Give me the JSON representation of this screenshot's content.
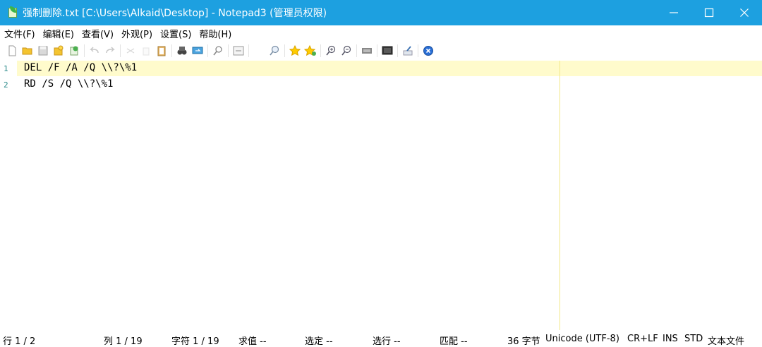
{
  "window": {
    "title": "强制删除.txt [C:\\Users\\Alkaid\\Desktop] - Notepad3  (管理员权限)",
    "titlebar_color": "#1da0e0"
  },
  "menu": [
    {
      "label": "文件(F)"
    },
    {
      "label": "编辑(E)"
    },
    {
      "label": "查看(V)"
    },
    {
      "label": "外观(P)"
    },
    {
      "label": "设置(S)"
    },
    {
      "label": "帮助(H)"
    }
  ],
  "toolbar": [
    {
      "icon": "new-file-icon"
    },
    {
      "icon": "open-folder-icon"
    },
    {
      "icon": "save-icon"
    },
    {
      "icon": "save-as-icon"
    },
    {
      "icon": "recent-files-icon"
    },
    {
      "icon": "undo-icon"
    },
    {
      "icon": "redo-icon"
    },
    {
      "icon": "cut-icon"
    },
    {
      "icon": "copy-icon"
    },
    {
      "icon": "paste-icon"
    },
    {
      "icon": "find-icon"
    },
    {
      "icon": "replace-icon"
    },
    {
      "icon": "goto-icon"
    },
    {
      "icon": "word-wrap-icon"
    },
    {
      "icon": "zoom-search-icon"
    },
    {
      "icon": "bookmark-icon"
    },
    {
      "icon": "add-bookmark-icon"
    },
    {
      "icon": "zoom-in-icon"
    },
    {
      "icon": "zoom-out-icon"
    },
    {
      "icon": "schema-icon"
    },
    {
      "icon": "screen-icon"
    },
    {
      "icon": "pin-icon"
    },
    {
      "icon": "exit-icon"
    }
  ],
  "editor": {
    "lines": [
      {
        "num": "1",
        "text": "DEL /F /A /Q \\\\?\\%1"
      },
      {
        "num": "2",
        "text": "RD /S /Q \\\\?\\%1"
      }
    ],
    "current_line_color": "#fffbcc"
  },
  "status": {
    "line": "行 1 / 2",
    "col": "列 1 / 19",
    "char": "字符 1 / 19",
    "value": "求值 --",
    "selection": "选定 --",
    "selected_lines": "选行 --",
    "match": "匹配 --",
    "bytes": "36 字节",
    "encoding": "Unicode (UTF-8)",
    "eol": "CR+LF",
    "ins": "INS",
    "std": "STD",
    "lexer": "文本文件"
  }
}
